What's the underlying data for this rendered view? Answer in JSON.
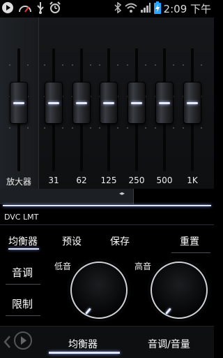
{
  "status_bar": {
    "time": "2:09 下午",
    "icons": [
      "play-icon",
      "gauge-icon",
      "usb-icon",
      "alarm-icon",
      "bluetooth-icon",
      "wifi-icon",
      "signal-icon",
      "battery-charging-icon"
    ]
  },
  "equalizer": {
    "bands": [
      {
        "label": "放大器",
        "level": 0.5
      },
      {
        "label": "31",
        "level": 0.5
      },
      {
        "label": "62",
        "level": 0.5
      },
      {
        "label": "125",
        "level": 0.5
      },
      {
        "label": "250",
        "level": 0.5
      },
      {
        "label": "500",
        "level": 0.5
      },
      {
        "label": "1K",
        "level": 0.5
      }
    ],
    "scroll_arrows": "◂▸"
  },
  "dvc_label": "DVC LMT",
  "sub_tabs": {
    "equalizer": "均衡器",
    "preset": "预设",
    "save": "保存",
    "reset": "重置"
  },
  "side_menu": {
    "tone": "音调",
    "limit": "限制"
  },
  "dials": {
    "bass_label": "低音",
    "treble_label": "高音"
  },
  "bottom_tabs": {
    "equalizer": "均衡器",
    "tone_volume": "音调/音量"
  },
  "colors": {
    "accent": "#dfe6ff",
    "background": "#000000"
  }
}
